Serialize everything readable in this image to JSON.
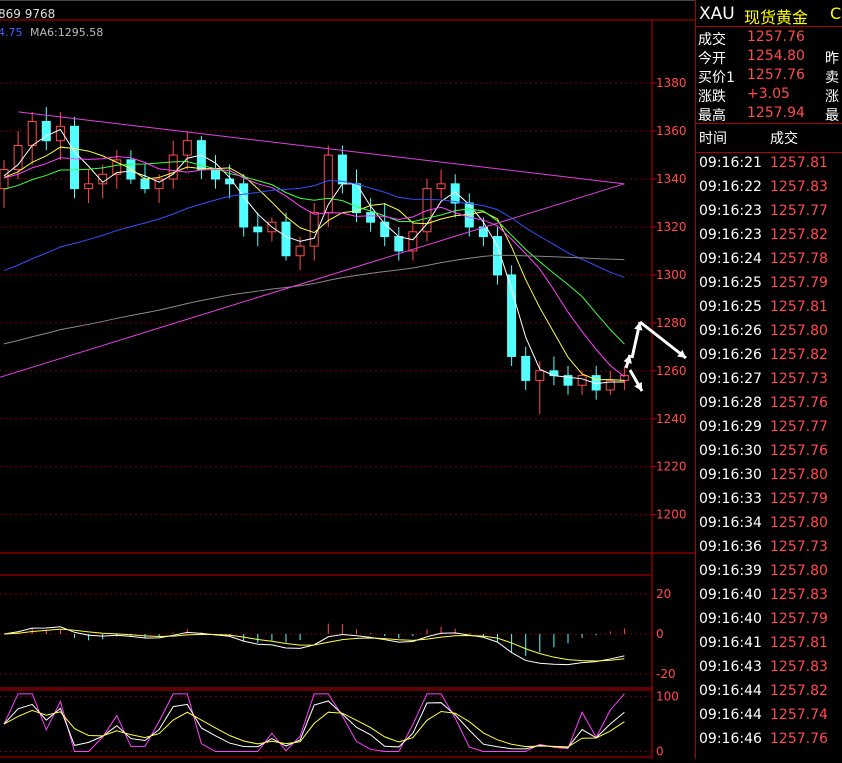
{
  "chart_data": [
    {
      "type": "candlestick",
      "legend_text": [
        "869 9768",
        "4.75",
        "MA6:1295.58"
      ],
      "y_ticks": [
        1200,
        1220,
        1240,
        1260,
        1280,
        1300,
        1320,
        1340,
        1360,
        1380
      ],
      "ylim": [
        1184,
        1398
      ],
      "candles": [
        [
          1336,
          1348,
          1328,
          1344
        ],
        [
          1344,
          1360,
          1340,
          1354
        ],
        [
          1354,
          1368,
          1346,
          1364
        ],
        [
          1364,
          1370,
          1352,
          1356
        ],
        [
          1356,
          1368,
          1348,
          1362
        ],
        [
          1362,
          1366,
          1332,
          1336
        ],
        [
          1336,
          1344,
          1330,
          1338
        ],
        [
          1338,
          1346,
          1332,
          1342
        ],
        [
          1342,
          1352,
          1336,
          1348
        ],
        [
          1348,
          1352,
          1338,
          1340
        ],
        [
          1340,
          1346,
          1334,
          1336
        ],
        [
          1336,
          1342,
          1330,
          1340
        ],
        [
          1340,
          1356,
          1336,
          1350
        ],
        [
          1350,
          1360,
          1344,
          1356
        ],
        [
          1356,
          1358,
          1340,
          1344
        ],
        [
          1344,
          1350,
          1336,
          1340
        ],
        [
          1340,
          1346,
          1332,
          1338
        ],
        [
          1338,
          1342,
          1316,
          1320
        ],
        [
          1320,
          1326,
          1312,
          1318
        ],
        [
          1318,
          1324,
          1314,
          1322
        ],
        [
          1322,
          1326,
          1306,
          1308
        ],
        [
          1308,
          1316,
          1302,
          1312
        ],
        [
          1312,
          1330,
          1306,
          1326
        ],
        [
          1326,
          1354,
          1320,
          1350
        ],
        [
          1350,
          1354,
          1334,
          1338
        ],
        [
          1338,
          1344,
          1322,
          1326
        ],
        [
          1326,
          1332,
          1318,
          1322
        ],
        [
          1322,
          1330,
          1312,
          1316
        ],
        [
          1316,
          1320,
          1306,
          1310
        ],
        [
          1310,
          1322,
          1306,
          1318
        ],
        [
          1318,
          1340,
          1314,
          1336
        ],
        [
          1336,
          1344,
          1332,
          1338
        ],
        [
          1338,
          1342,
          1324,
          1330
        ],
        [
          1330,
          1334,
          1316,
          1320
        ],
        [
          1320,
          1324,
          1312,
          1316
        ],
        [
          1316,
          1320,
          1296,
          1300
        ],
        [
          1300,
          1304,
          1262,
          1266
        ],
        [
          1266,
          1270,
          1252,
          1256
        ],
        [
          1256,
          1264,
          1242,
          1260
        ],
        [
          1260,
          1266,
          1254,
          1258
        ],
        [
          1258,
          1262,
          1250,
          1254
        ],
        [
          1254,
          1260,
          1250,
          1258
        ],
        [
          1258,
          1262,
          1248,
          1252
        ],
        [
          1252,
          1260,
          1250,
          1256
        ],
        [
          1256,
          1262,
          1252,
          1258
        ]
      ],
      "trendlines": [
        {
          "color": "#e040e0",
          "x1": 1,
          "y1": 1368,
          "x2": 44,
          "y2": 1338
        },
        {
          "color": "#e040e0",
          "x1": -1,
          "y1": 1256,
          "x2": 44,
          "y2": 1338
        }
      ],
      "forecast_arrows": true
    },
    {
      "type": "histogram_macd",
      "y_ticks": [
        20,
        0,
        -20
      ],
      "ylim": [
        -27,
        27
      ]
    },
    {
      "type": "line_oscillator",
      "y_ticks": [
        100,
        0
      ],
      "ylim": [
        -10,
        112
      ]
    }
  ],
  "quote_panel": {
    "symbol": "XAU",
    "name": "现货黄金",
    "code_partial": "C",
    "rows": [
      {
        "label": "成交",
        "value": "1257.76",
        "label2": ""
      },
      {
        "label": "今开",
        "value": "1254.80",
        "label2": "昨"
      },
      {
        "label": "买价1",
        "value": "1257.76",
        "label2": "卖"
      },
      {
        "label": "涨跌",
        "value": "+3.05",
        "label2": "涨"
      },
      {
        "label": "最高",
        "value": "1257.94",
        "label2": "最"
      }
    ],
    "ticks_header": {
      "time": "时间",
      "price": "成交"
    },
    "ticks": [
      [
        "09:16:21",
        "1257.81"
      ],
      [
        "09:16:22",
        "1257.83"
      ],
      [
        "09:16:23",
        "1257.77"
      ],
      [
        "09:16:23",
        "1257.82"
      ],
      [
        "09:16:24",
        "1257.78"
      ],
      [
        "09:16:25",
        "1257.79"
      ],
      [
        "09:16:25",
        "1257.81"
      ],
      [
        "09:16:26",
        "1257.80"
      ],
      [
        "09:16:26",
        "1257.82"
      ],
      [
        "09:16:27",
        "1257.73"
      ],
      [
        "09:16:28",
        "1257.76"
      ],
      [
        "09:16:29",
        "1257.77"
      ],
      [
        "09:16:30",
        "1257.76"
      ],
      [
        "09:16:30",
        "1257.80"
      ],
      [
        "09:16:33",
        "1257.79"
      ],
      [
        "09:16:34",
        "1257.80"
      ],
      [
        "09:16:36",
        "1257.73"
      ],
      [
        "09:16:39",
        "1257.80"
      ],
      [
        "09:16:40",
        "1257.83"
      ],
      [
        "09:16:40",
        "1257.79"
      ],
      [
        "09:16:41",
        "1257.81"
      ],
      [
        "09:16:43",
        "1257.83"
      ],
      [
        "09:16:44",
        "1257.82"
      ],
      [
        "09:16:44",
        "1257.74"
      ],
      [
        "09:16:46",
        "1257.76"
      ]
    ]
  },
  "colors": {
    "up": "#ff4b4b",
    "down": "#54ffff",
    "grid": "#7a0000",
    "axis": "#c00000",
    "ma5": "#ffffff",
    "ma10": "#ffff40",
    "ma20": "#ff40ff",
    "ma30": "#40ff40",
    "ma60": "#3050ff",
    "ma120": "#888888"
  }
}
